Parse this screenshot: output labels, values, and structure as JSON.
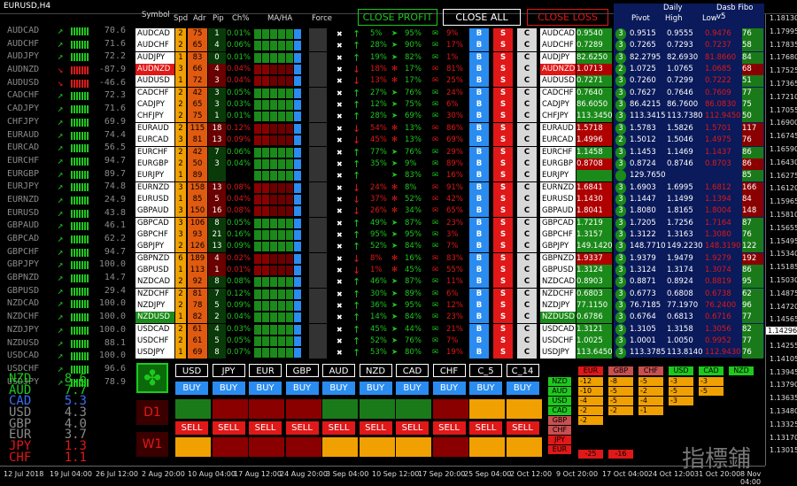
{
  "window": {
    "title": "EURUSD,H4"
  },
  "left_panel": {
    "rows": [
      {
        "sym": "AUDCAD",
        "dir": "up",
        "val": "70.6"
      },
      {
        "sym": "AUDCHF",
        "dir": "up",
        "val": "71.6"
      },
      {
        "sym": "AUDJPY",
        "dir": "up",
        "val": "72.2"
      },
      {
        "sym": "AUDNZD",
        "dir": "down",
        "val": "-87.9"
      },
      {
        "sym": "AUDUSD",
        "dir": "down",
        "val": "-46.6"
      },
      {
        "sym": "CADCHF",
        "dir": "up",
        "val": "72.3"
      },
      {
        "sym": "CADJPY",
        "dir": "up",
        "val": "71.6"
      },
      {
        "sym": "CHFJPY",
        "dir": "up",
        "val": "69.9"
      },
      {
        "sym": "EURAUD",
        "dir": "up",
        "val": "74.4"
      },
      {
        "sym": "EURCAD",
        "dir": "up",
        "val": "56.5"
      },
      {
        "sym": "EURCHF",
        "dir": "up",
        "val": "94.7"
      },
      {
        "sym": "EURGBP",
        "dir": "up",
        "val": "89.7"
      },
      {
        "sym": "EURJPY",
        "dir": "up",
        "val": "74.8"
      },
      {
        "sym": "EURNZD",
        "dir": "up",
        "val": "24.9"
      },
      {
        "sym": "EURUSD",
        "dir": "up",
        "val": "43.8"
      },
      {
        "sym": "GBPAUD",
        "dir": "up",
        "val": "46.1"
      },
      {
        "sym": "GBPCAD",
        "dir": "up",
        "val": "62.2"
      },
      {
        "sym": "GBPCHF",
        "dir": "up",
        "val": "94.7"
      },
      {
        "sym": "GBPJPY",
        "dir": "up",
        "val": "100.0"
      },
      {
        "sym": "GBPNZD",
        "dir": "up",
        "val": "14.7"
      },
      {
        "sym": "GBPUSD",
        "dir": "up",
        "val": "29.4"
      },
      {
        "sym": "NZDCAD",
        "dir": "up",
        "val": "100.0"
      },
      {
        "sym": "NZDCHF",
        "dir": "up",
        "val": "100.0"
      },
      {
        "sym": "NZDJPY",
        "dir": "up",
        "val": "100.0"
      },
      {
        "sym": "NZDUSD",
        "dir": "up",
        "val": "88.1"
      },
      {
        "sym": "USDCAD",
        "dir": "up",
        "val": "100.0"
      },
      {
        "sym": "USDCHF",
        "dir": "up",
        "val": "96.6"
      },
      {
        "sym": "USDJPY",
        "dir": "up",
        "val": "78.9"
      }
    ],
    "ranking": [
      {
        "cur": "NZD",
        "val": "8.6",
        "color": "#1ec81e"
      },
      {
        "cur": "AUD",
        "val": "7.7",
        "color": "#1ec81e"
      },
      {
        "cur": "CAD",
        "val": "5.3",
        "color": "#3f6cf0"
      },
      {
        "cur": "USD",
        "val": "4.3",
        "color": "#8a8a8a"
      },
      {
        "cur": "GBP",
        "val": "4.0",
        "color": "#8a8a8a"
      },
      {
        "cur": "EUR",
        "val": "3.7",
        "color": "#8a8a8a"
      },
      {
        "cur": "JPY",
        "val": "1.3",
        "color": "#e01818"
      },
      {
        "cur": "CHF",
        "val": "1.1",
        "color": "#e01818"
      }
    ]
  },
  "scanner": {
    "headers": {
      "symbol": "Symbol",
      "spd": "Spd",
      "adr": "Adr",
      "pip": "Pip",
      "ch": "Ch%",
      "maha": "MA/HA",
      "force": "Force"
    },
    "close_profit": "CLOSE PROFIT",
    "close_all": "CLOSE ALL",
    "close_loss": "CLOSE LOSS",
    "buy": "B",
    "sell": "S",
    "close": "C",
    "rows": [
      {
        "sym": "AUDCAD",
        "spd": "2",
        "adr": "75",
        "pip": "1",
        "ch": "0.01%",
        "dir": "up",
        "p1": "5%",
        "p2": "95%",
        "p3": "9%",
        "neg": false
      },
      {
        "sym": "AUDCHF",
        "spd": "2",
        "adr": "65",
        "pip": "4",
        "ch": "0.06%",
        "dir": "up",
        "p1": "28%",
        "p2": "90%",
        "p3": "17%",
        "neg": false
      },
      {
        "sym": "AUDJPY",
        "spd": "1",
        "adr": "83",
        "pip": "0",
        "ch": "0.01%",
        "dir": "up",
        "p1": "19%",
        "p2": "82%",
        "p3": "1%",
        "neg": false
      },
      {
        "sym": "AUDNZD",
        "spd": "3",
        "adr": "66",
        "pip": "4",
        "ch": "0.04%",
        "dir": "down",
        "p1": "18%",
        "p2": "17%",
        "p3": "81%",
        "neg": true
      },
      {
        "sym": "AUDUSD",
        "spd": "1",
        "adr": "72",
        "pip": "3",
        "ch": "0.04%",
        "dir": "down",
        "p1": "13%",
        "p2": "17%",
        "p3": "25%",
        "neg": true
      },
      {
        "sym": "CADCHF",
        "spd": "2",
        "adr": "42",
        "pip": "3",
        "ch": "0.05%",
        "dir": "up",
        "p1": "27%",
        "p2": "76%",
        "p3": "24%",
        "neg": false
      },
      {
        "sym": "CADJPY",
        "spd": "2",
        "adr": "65",
        "pip": "3",
        "ch": "0.03%",
        "dir": "up",
        "p1": "12%",
        "p2": "75%",
        "p3": "6%",
        "neg": false
      },
      {
        "sym": "CHFJPY",
        "spd": "2",
        "adr": "75",
        "pip": "1",
        "ch": "0.01%",
        "dir": "up",
        "p1": "28%",
        "p2": "69%",
        "p3": "30%",
        "neg": false
      },
      {
        "sym": "EURAUD",
        "spd": "2",
        "adr": "115",
        "pip": "18",
        "ch": "0.12%",
        "dir": "down",
        "p1": "54%",
        "p2": "13%",
        "p3": "86%",
        "neg": true
      },
      {
        "sym": "EURCAD",
        "spd": "3",
        "adr": "81",
        "pip": "13",
        "ch": "0.09%",
        "dir": "down",
        "p1": "45%",
        "p2": "13%",
        "p3": "69%",
        "neg": true
      },
      {
        "sym": "EURCHF",
        "spd": "2",
        "adr": "42",
        "pip": "7",
        "ch": "0.06%",
        "dir": "up",
        "p1": "77%",
        "p2": "76%",
        "p3": "29%",
        "neg": false
      },
      {
        "sym": "EURGBP",
        "spd": "2",
        "adr": "50",
        "pip": "3",
        "ch": "0.04%",
        "dir": "up",
        "p1": "35%",
        "p2": "9%",
        "p3": "89%",
        "neg": false
      },
      {
        "sym": "EURJPY",
        "spd": "1",
        "adr": "89",
        "pip": "",
        "ch": "",
        "dir": "up",
        "p1": "",
        "p2": "83%",
        "p3": "16%",
        "neg": false
      },
      {
        "sym": "EURNZD",
        "spd": "3",
        "adr": "158",
        "pip": "13",
        "ch": "0.08%",
        "dir": "down",
        "p1": "24%",
        "p2": "8%",
        "p3": "91%",
        "neg": true
      },
      {
        "sym": "EURUSD",
        "spd": "1",
        "adr": "85",
        "pip": "5",
        "ch": "0.04%",
        "dir": "down",
        "p1": "37%",
        "p2": "52%",
        "p3": "42%",
        "neg": true
      },
      {
        "sym": "GBPAUD",
        "spd": "3",
        "adr": "150",
        "pip": "16",
        "ch": "0.08%",
        "dir": "down",
        "p1": "26%",
        "p2": "34%",
        "p3": "65%",
        "neg": true
      },
      {
        "sym": "GBPCAD",
        "spd": "3",
        "adr": "106",
        "pip": "8",
        "ch": "0.05%",
        "dir": "up",
        "p1": "49%",
        "p2": "87%",
        "p3": "23%",
        "neg": false
      },
      {
        "sym": "GBPCHF",
        "spd": "3",
        "adr": "93",
        "pip": "21",
        "ch": "0.16%",
        "dir": "up",
        "p1": "95%",
        "p2": "95%",
        "p3": "3%",
        "neg": false
      },
      {
        "sym": "GBPJPY",
        "spd": "2",
        "adr": "126",
        "pip": "13",
        "ch": "0.09%",
        "dir": "up",
        "p1": "52%",
        "p2": "84%",
        "p3": "7%",
        "neg": false
      },
      {
        "sym": "GBPNZD",
        "spd": "6",
        "adr": "189",
        "pip": "4",
        "ch": "0.02%",
        "dir": "down",
        "p1": "8%",
        "p2": "16%",
        "p3": "83%",
        "neg": true
      },
      {
        "sym": "GBPUSD",
        "spd": "1",
        "adr": "113",
        "pip": "1",
        "ch": "0.01%",
        "dir": "down",
        "p1": "1%",
        "p2": "45%",
        "p3": "55%",
        "neg": true
      },
      {
        "sym": "NZDCAD",
        "spd": "2",
        "adr": "92",
        "pip": "8",
        "ch": "0.08%",
        "dir": "up",
        "p1": "46%",
        "p2": "87%",
        "p3": "11%",
        "neg": false
      },
      {
        "sym": "NZDCHF",
        "spd": "2",
        "adr": "81",
        "pip": "7",
        "ch": "0.12%",
        "dir": "up",
        "p1": "30%",
        "p2": "89%",
        "p3": "6%",
        "neg": false
      },
      {
        "sym": "NZDJPY",
        "spd": "2",
        "adr": "78",
        "pip": "5",
        "ch": "0.09%",
        "dir": "up",
        "p1": "36%",
        "p2": "95%",
        "p3": "12%",
        "neg": false
      },
      {
        "sym": "NZDUSD",
        "spd": "1",
        "adr": "82",
        "pip": "2",
        "ch": "0.04%",
        "dir": "up",
        "p1": "14%",
        "p2": "84%",
        "p3": "23%",
        "neg": false
      },
      {
        "sym": "USDCAD",
        "spd": "2",
        "adr": "61",
        "pip": "4",
        "ch": "0.03%",
        "dir": "up",
        "p1": "45%",
        "p2": "44%",
        "p3": "21%",
        "neg": false
      },
      {
        "sym": "USDCHF",
        "spd": "2",
        "adr": "61",
        "pip": "5",
        "ch": "0.05%",
        "dir": "up",
        "p1": "52%",
        "p2": "76%",
        "p3": "7%",
        "neg": false
      },
      {
        "sym": "USDJPY",
        "spd": "1",
        "adr": "69",
        "pip": "8",
        "ch": "0.07%",
        "dir": "up",
        "p1": "53%",
        "p2": "80%",
        "p3": "19%",
        "neg": false
      }
    ]
  },
  "daily": {
    "title": "Daily",
    "version": "Dasb Fibo  v5",
    "pivot": "Pivot",
    "high": "High",
    "low": "Low",
    "rows": [
      {
        "sym": "AUDCAD",
        "p": "0.9540",
        "n": "3",
        "pv": "0.9515",
        "h": "0.9555",
        "l": "0.9476",
        "x": "76",
        "neg": false
      },
      {
        "sym": "AUDCHF",
        "p": "0.7289",
        "n": "3",
        "pv": "0.7265",
        "h": "0.7293",
        "l": "0.7237",
        "x": "58",
        "neg": false
      },
      {
        "sym": "AUDJPY",
        "p": "82.6250",
        "n": "3",
        "pv": "82.2795",
        "h": "82.6930",
        "l": "81.8660",
        "x": "84",
        "neg": false
      },
      {
        "sym": "AUDNZD",
        "p": "1.0713",
        "n": "2",
        "pv": "1.0725",
        "h": "1.0765",
        "l": "1.0685",
        "x": "68",
        "neg": true
      },
      {
        "sym": "AUDUSD",
        "p": "0.7271",
        "n": "3",
        "pv": "0.7260",
        "h": "0.7299",
        "l": "0.7222",
        "x": "51",
        "neg": false
      },
      {
        "sym": "CADCHF",
        "p": "0.7640",
        "n": "3",
        "pv": "0.7627",
        "h": "0.7646",
        "l": "0.7609",
        "x": "77",
        "neg": false
      },
      {
        "sym": "CADJPY",
        "p": "86.6050",
        "n": "3",
        "pv": "86.4215",
        "h": "86.7600",
        "l": "86.0830",
        "x": "75",
        "neg": false
      },
      {
        "sym": "CHFJPY",
        "p": "113.3450",
        "n": "3",
        "pv": "113.3415",
        "h": "113.7380",
        "l": "112.9450",
        "x": "50",
        "neg": false
      },
      {
        "sym": "EURAUD",
        "p": "1.5718",
        "n": "3",
        "pv": "1.5783",
        "h": "1.5826",
        "l": "1.5701",
        "x": "117",
        "neg": true
      },
      {
        "sym": "EURCAD",
        "p": "1.4996",
        "n": "2",
        "pv": "1.5012",
        "h": "1.5046",
        "l": "1.4975",
        "x": "76",
        "neg": true
      },
      {
        "sym": "EURCHF",
        "p": "1.1458",
        "n": "3",
        "pv": "1.1453",
        "h": "1.1469",
        "l": "1.1437",
        "x": "86",
        "neg": false
      },
      {
        "sym": "EURGBP",
        "p": "0.8708",
        "n": "3",
        "pv": "0.8724",
        "h": "0.8746",
        "l": "0.8703",
        "x": "86",
        "neg": true
      },
      {
        "sym": "EURJPY",
        "p": "",
        "n": "",
        "pv": "129.7650",
        "h": "",
        "l": "",
        "x": "85",
        "neg": false
      },
      {
        "sym": "EURNZD",
        "p": "1.6841",
        "n": "3",
        "pv": "1.6903",
        "h": "1.6995",
        "l": "1.6812",
        "x": "166",
        "neg": true
      },
      {
        "sym": "EURUSD",
        "p": "1.1430",
        "n": "3",
        "pv": "1.1447",
        "h": "1.1499",
        "l": "1.1394",
        "x": "84",
        "neg": true
      },
      {
        "sym": "GBPAUD",
        "p": "1.8041",
        "n": "3",
        "pv": "1.8080",
        "h": "1.8165",
        "l": "1.8004",
        "x": "148",
        "neg": true
      },
      {
        "sym": "GBPCAD",
        "p": "1.7219",
        "n": "3",
        "pv": "1.7205",
        "h": "1.7256",
        "l": "1.7164",
        "x": "87",
        "neg": false
      },
      {
        "sym": "GBPCHF",
        "p": "1.3157",
        "n": "3",
        "pv": "1.3122",
        "h": "1.3163",
        "l": "1.3080",
        "x": "76",
        "neg": false
      },
      {
        "sym": "GBPJPY",
        "p": "149.1420",
        "n": "3",
        "pv": "148.7710",
        "h": "149.2230",
        "l": "148.3190",
        "x": "122",
        "neg": false
      },
      {
        "sym": "GBPNZD",
        "p": "1.9337",
        "n": "3",
        "pv": "1.9379",
        "h": "1.9479",
        "l": "1.9279",
        "x": "192",
        "neg": true
      },
      {
        "sym": "GBPUSD",
        "p": "1.3124",
        "n": "3",
        "pv": "1.3124",
        "h": "1.3174",
        "l": "1.3074",
        "x": "86",
        "neg": false
      },
      {
        "sym": "NZDCAD",
        "p": "0.8903",
        "n": "3",
        "pv": "0.8871",
        "h": "0.8924",
        "l": "0.8819",
        "x": "95",
        "neg": false
      },
      {
        "sym": "NZDCHF",
        "p": "0.6803",
        "n": "3",
        "pv": "0.6773",
        "h": "0.6808",
        "l": "0.6738",
        "x": "62",
        "neg": false
      },
      {
        "sym": "NZDJPY",
        "p": "77.1150",
        "n": "3",
        "pv": "76.7185",
        "h": "77.1970",
        "l": "76.2400",
        "x": "96",
        "neg": false
      },
      {
        "sym": "NZDUSD",
        "p": "0.6786",
        "n": "3",
        "pv": "0.6764",
        "h": "0.6813",
        "l": "0.6716",
        "x": "77",
        "neg": false
      },
      {
        "sym": "USDCAD",
        "p": "1.3121",
        "n": "3",
        "pv": "1.3105",
        "h": "1.3158",
        "l": "1.3056",
        "x": "82",
        "neg": false
      },
      {
        "sym": "USDCHF",
        "p": "1.0025",
        "n": "3",
        "pv": "1.0001",
        "h": "1.0050",
        "l": "0.9952",
        "x": "77",
        "neg": false
      },
      {
        "sym": "USDJPY",
        "p": "113.6450",
        "n": "3",
        "pv": "113.3785",
        "h": "113.8140",
        "l": "112.9430",
        "x": "76",
        "neg": false
      }
    ]
  },
  "currency_panel": {
    "currencies": [
      "USD",
      "JPY",
      "EUR",
      "GBP",
      "AUD",
      "NZD",
      "CAD",
      "CHF",
      "C_5",
      "C_14"
    ],
    "buy": "BUY",
    "sell": "SELL",
    "d1": "D1",
    "w1": "W1",
    "d1_colors": [
      "#1a7a1a",
      "#8a0000",
      "#8a0000",
      "#8a0000",
      "#1a7a1a",
      "#1a7a1a",
      "#1a7a1a",
      "#8a0000",
      "#f0a000",
      "#f0a000"
    ],
    "w1_colors": [
      "#f0a000",
      "#8a0000",
      "#8a0000",
      "#8a0000",
      "#f0a000",
      "#f0a000",
      "#f0a000",
      "#8a0000",
      "#f0a000",
      "#f0a000"
    ]
  },
  "strength_matrix": {
    "rows": [
      "NZD",
      "AUD",
      "USD",
      "CAD",
      "GBP",
      "CHF",
      "JPY",
      "EUR"
    ],
    "cols": [
      "EUR",
      "GBP",
      "CHF",
      "USD",
      "CAD",
      "NZD"
    ],
    "data": [
      [
        "-12",
        "-8",
        "-5",
        "-3",
        "-3",
        ""
      ],
      [
        "-10",
        "-5",
        "-2",
        "-5",
        "-5",
        ""
      ],
      [
        "-4",
        "-5",
        "-4",
        "-3",
        "",
        ""
      ],
      [
        "-2",
        "-2",
        "-1",
        "",
        "",
        ""
      ],
      [
        "-2",
        "",
        "",
        "",
        "",
        ""
      ],
      [
        "",
        "",
        "",
        "",
        "",
        ""
      ],
      [
        "",
        "",
        "",
        "",
        "",
        ""
      ],
      [
        "",
        "",
        "",
        "",
        "",
        ""
      ]
    ],
    "totals": [
      "-25",
      "-16"
    ]
  },
  "y_axis": [
    "1.18130",
    "1.17995",
    "1.17835",
    "1.17680",
    "1.17525",
    "1.17365",
    "1.17210",
    "1.17055",
    "1.16900",
    "1.16745",
    "1.16590",
    "1.16430",
    "1.16275",
    "1.16120",
    "1.15965",
    "1.15810",
    "1.15655",
    "1.15495",
    "1.15340",
    "1.15185",
    "1.15030",
    "1.14875",
    "1.14720",
    "1.14565",
    "1.14296",
    "1.14255",
    "1.14105",
    "1.13945",
    "1.13790",
    "1.13635",
    "1.13480",
    "1.13325",
    "1.13170",
    "1.13015"
  ],
  "price_marker": "1.14296",
  "x_axis": [
    "12 Jul 2018",
    "19 Jul 04:00",
    "26 Jul 12:00",
    "2 Aug 20:00",
    "10 Aug 04:00",
    "17 Aug 12:00",
    "24 Aug 20:00",
    "3 Sep 04:00",
    "10 Sep 12:00",
    "17 Sep 20:00",
    "25 Sep 04:00",
    "2 Oct 12:00",
    "9 Oct 20:00",
    "17 Oct 04:00",
    "24 Oct 12:00",
    "31 Oct 20:00",
    "8 Nov 04:00"
  ],
  "watermark": "指標鋪"
}
